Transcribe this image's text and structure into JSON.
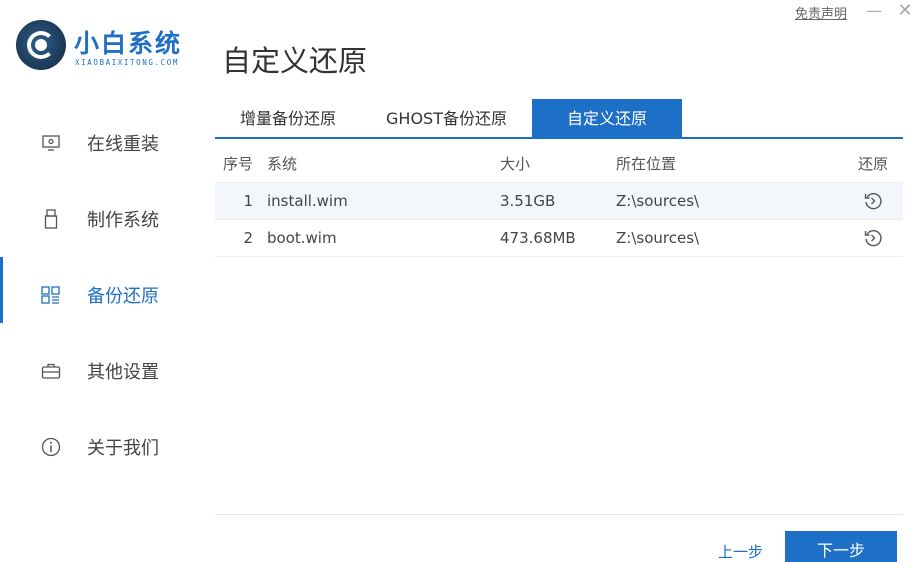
{
  "app": {
    "logo_title": "小白系统",
    "logo_subtitle": "XIAOBAIXITONG.COM",
    "page_title": "自定义还原",
    "disclaimer": "免责声明",
    "minimize_glyph": "—",
    "close_glyph": "✕"
  },
  "colors": {
    "accent": "#1e6fc6",
    "row_alt": "#f3f7fb"
  },
  "sidebar": {
    "items": [
      {
        "label": "在线重装",
        "icon": "monitor-icon",
        "active": false
      },
      {
        "label": "制作系统",
        "icon": "usb-icon",
        "active": false
      },
      {
        "label": "备份还原",
        "icon": "grid-icon",
        "active": true
      },
      {
        "label": "其他设置",
        "icon": "briefcase-icon",
        "active": false
      },
      {
        "label": "关于我们",
        "icon": "info-icon",
        "active": false
      }
    ]
  },
  "tabs": [
    {
      "label": "增量备份还原",
      "active": false
    },
    {
      "label": "GHOST备份还原",
      "active": false
    },
    {
      "label": "自定义还原",
      "active": true
    }
  ],
  "table": {
    "headers": {
      "idx": "序号",
      "system": "系统",
      "size": "大小",
      "location": "所在位置",
      "action": "还原"
    },
    "rows": [
      {
        "idx": "1",
        "system": "install.wim",
        "size": "3.51GB",
        "location": "Z:\\sources\\"
      },
      {
        "idx": "2",
        "system": "boot.wim",
        "size": "473.68MB",
        "location": "Z:\\sources\\"
      }
    ]
  },
  "footer": {
    "prev": "上一步",
    "next": "下一步"
  }
}
